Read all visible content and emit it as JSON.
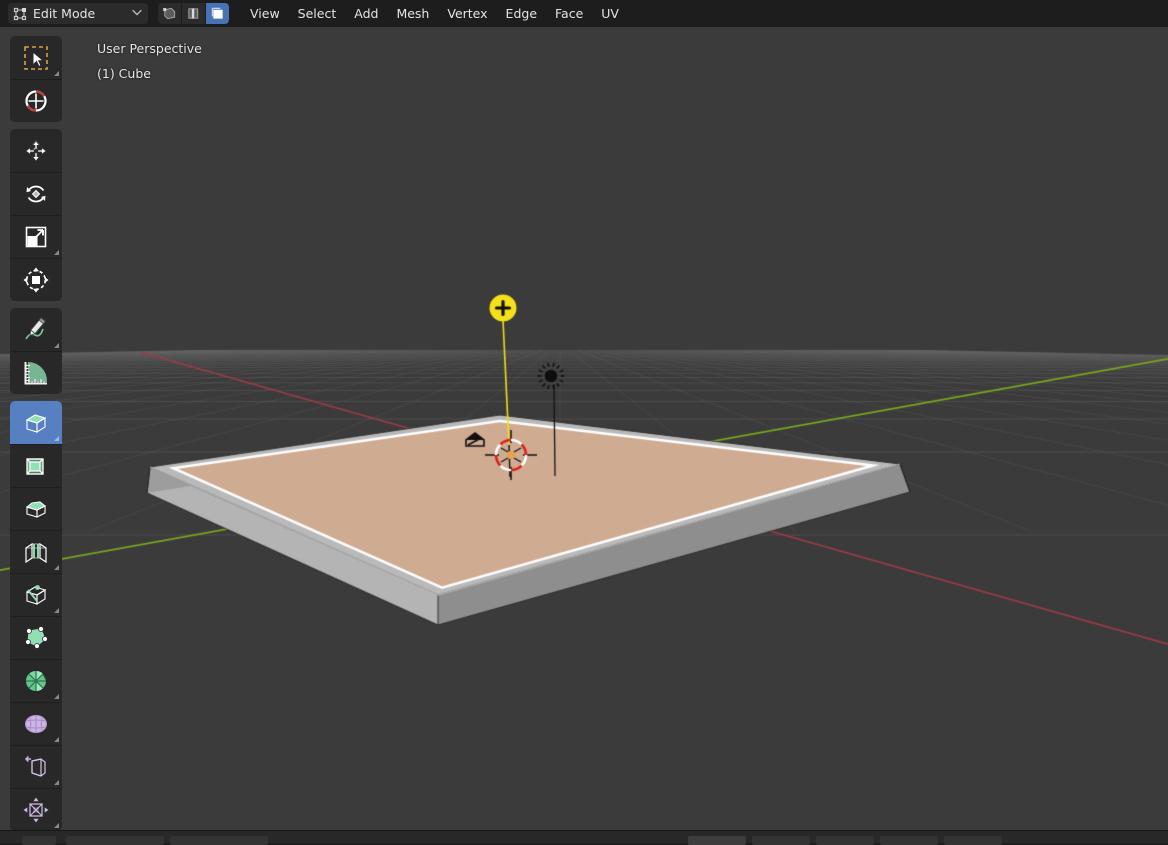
{
  "topbar": {
    "mode": {
      "label": "Edit Mode",
      "icon": "edit-mode-icon",
      "chevron": "chevron-down-icon"
    },
    "select_modes": [
      {
        "name": "vertex-select",
        "icon": "vertex-select-icon",
        "active": false
      },
      {
        "name": "edge-select",
        "icon": "edge-select-icon",
        "active": false
      },
      {
        "name": "face-select",
        "icon": "face-select-icon",
        "active": true
      }
    ],
    "menus": [
      {
        "label": "View"
      },
      {
        "label": "Select"
      },
      {
        "label": "Add"
      },
      {
        "label": "Mesh"
      },
      {
        "label": "Vertex"
      },
      {
        "label": "Edge"
      },
      {
        "label": "Face"
      },
      {
        "label": "UV"
      }
    ]
  },
  "viewport": {
    "perspective_label": "User Perspective",
    "object_label": "(1) Cube",
    "background_color": "#3b3b3b",
    "grid_color": "#4a4a4a",
    "axis_x_color": "#9e3b45",
    "axis_y_color": "#77a81e",
    "selected_face_color": "#cfab92",
    "mesh_side_color": "#9a9a9a",
    "selected_edge_color": "#ffffff",
    "objects": [
      {
        "name": "light-selected",
        "type": "light",
        "color": "#f5e11a",
        "selected": true
      },
      {
        "name": "light-unselected",
        "type": "light",
        "color": "#000000",
        "selected": false
      },
      {
        "name": "camera",
        "type": "camera",
        "color": "#000000",
        "selected": false
      },
      {
        "name": "cube-mesh",
        "type": "mesh",
        "selected": true
      },
      {
        "name": "3d-cursor",
        "type": "cursor",
        "color": "#ff2222"
      }
    ]
  },
  "toolbar": {
    "groups": [
      {
        "tools": [
          {
            "name": "tweak-select-box-tool",
            "label": "Select Box",
            "icon": "select-box-icon",
            "active": false,
            "expandable": true
          },
          {
            "name": "cursor-tool",
            "label": "Cursor",
            "icon": "cursor-3d-icon",
            "active": false,
            "expandable": false
          }
        ]
      },
      {
        "tools": [
          {
            "name": "move-tool",
            "label": "Move",
            "icon": "move-icon",
            "active": false,
            "expandable": false
          },
          {
            "name": "rotate-tool",
            "label": "Rotate",
            "icon": "rotate-icon",
            "active": false,
            "expandable": false
          },
          {
            "name": "scale-tool",
            "label": "Scale",
            "icon": "scale-icon",
            "active": false,
            "expandable": true
          },
          {
            "name": "transform-tool",
            "label": "Transform",
            "icon": "transform-icon",
            "active": false,
            "expandable": false
          }
        ]
      },
      {
        "tools": [
          {
            "name": "annotate-tool",
            "label": "Annotate",
            "icon": "annotate-pencil-icon",
            "active": false,
            "expandable": true
          },
          {
            "name": "measure-tool",
            "label": "Measure",
            "icon": "measure-ruler-icon",
            "active": false,
            "expandable": false
          }
        ]
      },
      {
        "tools": [
          {
            "name": "extrude-region-tool",
            "label": "Extrude Region",
            "icon": "extrude-region-icon",
            "active": true,
            "expandable": true
          },
          {
            "name": "inset-faces-tool",
            "label": "Inset Faces",
            "icon": "inset-faces-icon",
            "active": false,
            "expandable": false
          },
          {
            "name": "bevel-tool",
            "label": "Bevel",
            "icon": "bevel-icon",
            "active": false,
            "expandable": false
          },
          {
            "name": "loop-cut-tool",
            "label": "Loop Cut",
            "icon": "loop-cut-icon",
            "active": false,
            "expandable": true
          },
          {
            "name": "knife-tool",
            "label": "Knife",
            "icon": "knife-icon",
            "active": false,
            "expandable": true
          },
          {
            "name": "poly-build-tool",
            "label": "Poly Build",
            "icon": "poly-build-icon",
            "active": false,
            "expandable": false
          },
          {
            "name": "spin-tool",
            "label": "Spin",
            "icon": "spin-icon",
            "active": false,
            "expandable": true
          },
          {
            "name": "smooth-tool",
            "label": "Smooth",
            "icon": "smooth-icon",
            "active": false,
            "expandable": true
          },
          {
            "name": "shear-tool",
            "label": "Shear",
            "icon": "shear-icon",
            "active": false,
            "expandable": true
          },
          {
            "name": "rip-region-tool",
            "label": "Rip Region",
            "icon": "rip-region-icon",
            "active": false,
            "expandable": true
          }
        ]
      }
    ]
  },
  "bottom_strip": {
    "visible": true
  }
}
